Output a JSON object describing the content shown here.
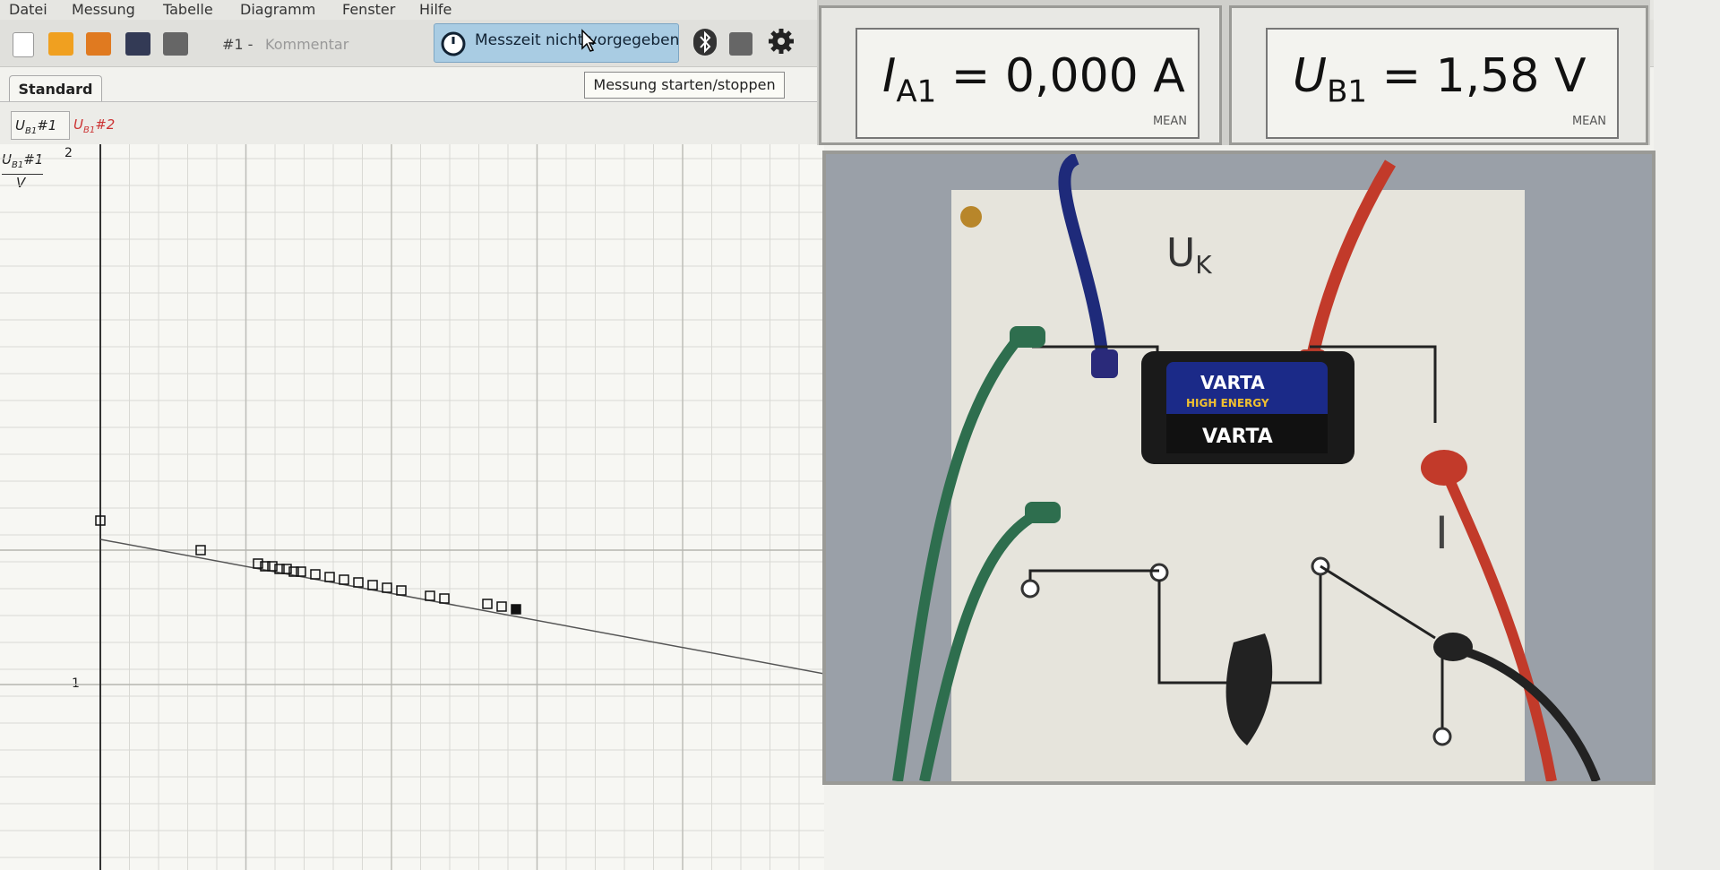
{
  "menu": [
    "Datei",
    "Messung",
    "Tabelle",
    "Diagramm",
    "Fenster",
    "Hilfe"
  ],
  "toolbar": {
    "set_label": "#1 -",
    "comment_placeholder": "Kommentar",
    "timer_label": "Messzeit nicht vorgegeben",
    "tooltip": "Messung starten/stoppen"
  },
  "tabs": {
    "standard": "Standard"
  },
  "series": {
    "s1": "U",
    "s1_sub": "B1",
    "s1_tag": "#1",
    "s2": "U",
    "s2_sub": "B1",
    "s2_tag": "#2"
  },
  "yaxis": {
    "label": "U",
    "label_sub": "B1",
    "label_tag": "#1",
    "unit": "V",
    "tick_top": "2",
    "tick_mid": "1"
  },
  "meters": [
    {
      "symbol": "I",
      "sub": "A1",
      "value": "= 0,000 A",
      "mode": "MEAN"
    },
    {
      "symbol": "U",
      "sub": "B1",
      "value": "= 1,58 V",
      "mode": "MEAN"
    }
  ],
  "circuit": {
    "label_uk": "U",
    "label_uk_sub": "K",
    "label_i": "I",
    "battery": "VARTA",
    "battery_sub": "HIGH ENERGY"
  },
  "chart_data": {
    "type": "scatter",
    "x": [
      0,
      0.7,
      1.1,
      1.15,
      1.2,
      1.25,
      1.3,
      1.35,
      1.4,
      1.5,
      1.6,
      1.7,
      1.8,
      1.9,
      2.0,
      2.1,
      2.3,
      2.4,
      2.7,
      2.8,
      2.9
    ],
    "y": [
      1.61,
      1.5,
      1.45,
      1.44,
      1.44,
      1.43,
      1.43,
      1.42,
      1.42,
      1.41,
      1.4,
      1.39,
      1.38,
      1.37,
      1.36,
      1.35,
      1.33,
      1.32,
      1.3,
      1.29,
      1.28
    ],
    "fit_line": {
      "x": [
        0,
        10
      ],
      "y": [
        1.54,
        0.55
      ]
    },
    "ylim": [
      0,
      2
    ],
    "grid": true,
    "colors": {
      "points": "#111111",
      "fit": "#555555",
      "series2": "#cc3333"
    }
  }
}
